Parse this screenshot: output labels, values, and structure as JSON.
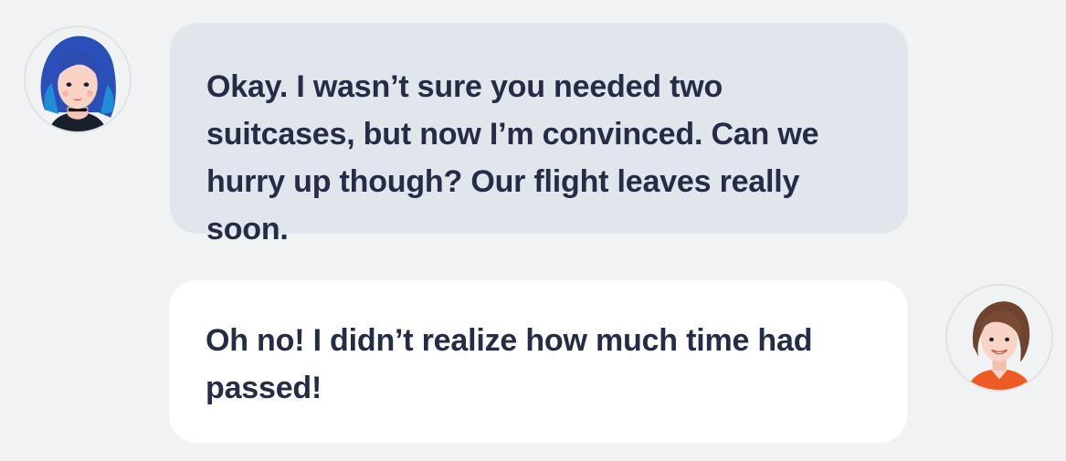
{
  "conversation": {
    "messages": [
      {
        "speaker_avatar": "woman-blue-hair-avatar",
        "text": "Okay. I wasn’t sure you needed two suitcases, but now I’m convinced. Can we hurry up though? Our flight leaves really soon."
      },
      {
        "speaker_avatar": "woman-brown-hair-avatar",
        "text": "Oh no! I didn’t realize how much time had passed!"
      }
    ]
  },
  "colors": {
    "background": "#f1f2f4",
    "incoming_bubble": "#e1e5ec",
    "outgoing_bubble": "#ffffff",
    "text": "#242d45"
  }
}
